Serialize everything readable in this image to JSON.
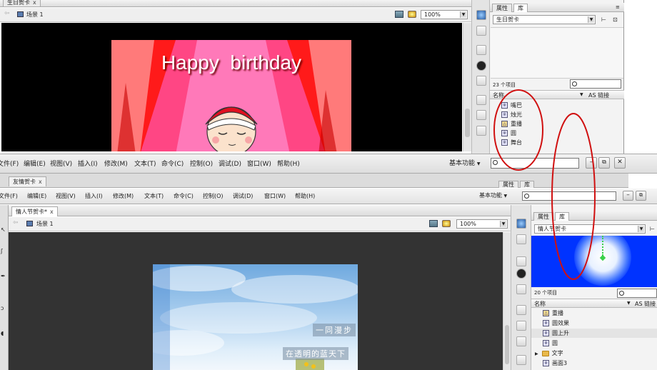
{
  "top_window": {
    "doc_tab": "生日贺卡",
    "scene_label": "场景 1",
    "zoom": "100%",
    "stage_text": "Happy  birthday",
    "colors": {
      "stage_bg": "#000000",
      "card_bg": "#ff1a1a",
      "text": "#ffffff"
    }
  },
  "top_library": {
    "tabs": [
      "属性",
      "库"
    ],
    "doc_select": "生日贺卡",
    "count": "23 个项目",
    "col_name": "名称",
    "col_link": "AS 链接",
    "items": [
      {
        "icon": "symbol-icon",
        "label": "嘴巴"
      },
      {
        "icon": "symbol-icon",
        "label": "烛光"
      },
      {
        "icon": "graphic-icon",
        "label": "重播"
      },
      {
        "icon": "symbol-icon",
        "label": "圆"
      },
      {
        "icon": "symbol-icon",
        "label": "舞台"
      }
    ]
  },
  "menubar": {
    "items": [
      "文件(F)",
      "编辑(E)",
      "视图(V)",
      "插入(I)",
      "修改(M)",
      "文本(T)",
      "命令(C)",
      "控制(O)",
      "调试(D)",
      "窗口(W)",
      "帮助(H)"
    ],
    "workspace": "基本功能"
  },
  "mid_window": {
    "doc_tab": "友情贺卡",
    "menu": [
      "文件(F)",
      "编辑(E)",
      "视图(V)",
      "插入(I)",
      "修改(M)",
      "文本(T)",
      "命令(C)",
      "控制(O)",
      "调试(D)",
      "窗口(W)",
      "帮助(H)"
    ],
    "workspace": "基本功能",
    "panel_tabs": [
      "属性",
      "库"
    ]
  },
  "bottom_window": {
    "doc_tab": "情人节贺卡*",
    "scene_label": "场景 1",
    "zoom": "100%",
    "stage_text_1": "一同漫步",
    "stage_text_2": "在透明的蓝天下",
    "colors": {
      "stage_bg": "#333333",
      "sky": "#8fc3ea"
    }
  },
  "bottom_library": {
    "tabs": [
      "属性",
      "库"
    ],
    "doc_select": "情人节贺卡",
    "count": "20 个项目",
    "col_name": "名称",
    "col_link": "AS 链接",
    "items": [
      {
        "icon": "graphic-icon",
        "label": "重播"
      },
      {
        "icon": "symbol-icon",
        "label": "圆效果"
      },
      {
        "icon": "symbol-icon",
        "label": "圆上升"
      },
      {
        "icon": "symbol-icon",
        "label": "圆"
      },
      {
        "icon": "folder-icon",
        "label": "文字"
      },
      {
        "icon": "symbol-icon",
        "label": "画面3"
      }
    ]
  },
  "annotation_color": "#d01010"
}
